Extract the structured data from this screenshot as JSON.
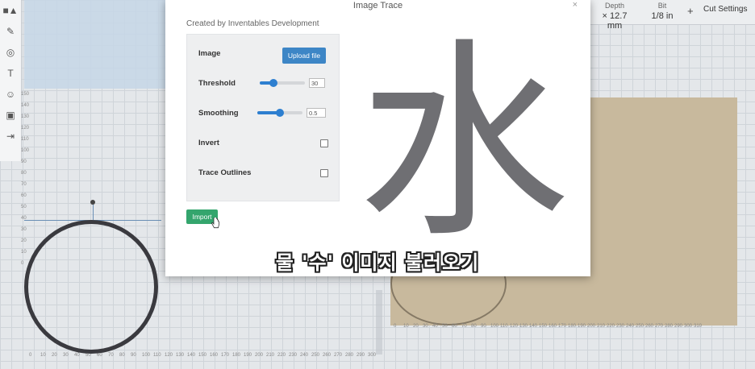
{
  "app": {
    "top_stats": [
      {
        "label": "Depth",
        "value": "× 12.7 mm"
      },
      {
        "label": "Bit",
        "value": "1/8 in"
      }
    ],
    "plus_label": "+",
    "cut_settings_label": "Cut Settings",
    "left_ruler": [
      "150",
      "140",
      "130",
      "120",
      "110",
      "100",
      "90",
      "80",
      "70",
      "60",
      "50",
      "40",
      "30",
      "20",
      "10",
      "0"
    ],
    "bottom_ruler": [
      "0",
      "10",
      "20",
      "30",
      "40",
      "50",
      "60",
      "70",
      "80",
      "90",
      "100",
      "110",
      "120",
      "130",
      "140",
      "150",
      "160",
      "170",
      "180",
      "190",
      "200",
      "210",
      "220",
      "230",
      "240",
      "250",
      "260",
      "270",
      "280",
      "290",
      "300"
    ],
    "bottom_ruler_right": [
      "0",
      "10",
      "20",
      "30",
      "40",
      "50",
      "60",
      "70",
      "80",
      "90",
      "100",
      "110",
      "120",
      "130",
      "140",
      "150",
      "160",
      "170",
      "180",
      "190",
      "200",
      "210",
      "220",
      "230",
      "240",
      "250",
      "260",
      "270",
      "280",
      "290",
      "300",
      "310"
    ]
  },
  "toolbar": {
    "items": [
      {
        "name": "shapes-icon",
        "glyph": "■▲"
      },
      {
        "name": "pen-icon",
        "glyph": "✎"
      },
      {
        "name": "target-icon",
        "glyph": "◎"
      },
      {
        "name": "text-icon",
        "glyph": "T"
      },
      {
        "name": "emoji-icon",
        "glyph": "☺"
      },
      {
        "name": "box-3d-icon",
        "glyph": "▣"
      },
      {
        "name": "import-icon",
        "glyph": "⇥"
      }
    ]
  },
  "modal": {
    "title": "Image Trace",
    "close_glyph": "×",
    "created_by": "Created by Inventables Development",
    "image_label": "Image",
    "upload_label": "Upload file",
    "threshold_label": "Threshold",
    "threshold_value": "30",
    "threshold_fraction": 0.3,
    "smoothing_label": "Smoothing",
    "smoothing_value": "0.5",
    "smoothing_fraction": 0.5,
    "invert_label": "Invert",
    "trace_outlines_label": "Trace Outlines",
    "import_label": "Import",
    "preview_glyph": "水"
  },
  "subtitle": "물 '수' 이미지 불러오기",
  "colors": {
    "accent_blue": "#3d86c6",
    "import_green": "#34a56d",
    "slider_blue": "#2d7fd0",
    "preview_gray": "#6f6f73"
  }
}
